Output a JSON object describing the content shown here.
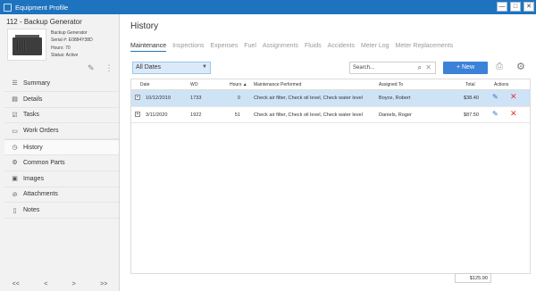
{
  "window": {
    "title": "Equipment Profile",
    "min": "—",
    "max": "□",
    "close": "✕"
  },
  "equipment": {
    "title": "112 - Backup Generator",
    "name": "Backup Generator",
    "serial": "Serial #: E0884Y38D",
    "hours": "Hours: 70",
    "status": "Status: Active"
  },
  "sidebar": {
    "items": [
      {
        "label": "Summary",
        "icon": "☰"
      },
      {
        "label": "Details",
        "icon": "▤"
      },
      {
        "label": "Tasks",
        "icon": "☑"
      },
      {
        "label": "Work Orders",
        "icon": "▭"
      },
      {
        "label": "History",
        "icon": "◷"
      },
      {
        "label": "Common Parts",
        "icon": "⚙"
      },
      {
        "label": "Images",
        "icon": "▣"
      },
      {
        "label": "Attachments",
        "icon": "⊘"
      },
      {
        "label": "Notes",
        "icon": "▯"
      }
    ],
    "pager": {
      "first": "<<",
      "prev": "<",
      "next": ">",
      "last": ">>"
    }
  },
  "main": {
    "title": "History",
    "tabs": [
      "Maintenance",
      "Inspections",
      "Expenses",
      "Fuel",
      "Assignments",
      "Fluids",
      "Accidents",
      "Meter Log",
      "Meter Replacements"
    ],
    "filter": {
      "selected": "All Dates"
    },
    "search": {
      "placeholder": "Search..."
    },
    "new_button": "+ New"
  },
  "table": {
    "headers": {
      "date": "Date",
      "wo": "WO",
      "hours": "Hours ▲",
      "maint": "Maintenance Performed",
      "assigned": "Assigned To",
      "total": "Total",
      "actions": "Actions"
    },
    "rows": [
      {
        "date": "10/12/2019",
        "wo": "1733",
        "hours": "0",
        "maint": "Check air filter, Check oil level, Check water level",
        "assigned": "Boyce, Robert",
        "total": "$38.40"
      },
      {
        "date": "3/11/2020",
        "wo": "1922",
        "hours": "51",
        "maint": "Check air filter, Check oil level, Check water level",
        "assigned": "Daniels, Roger",
        "total": "$87.50"
      }
    ],
    "grand_total": "$125.90"
  }
}
